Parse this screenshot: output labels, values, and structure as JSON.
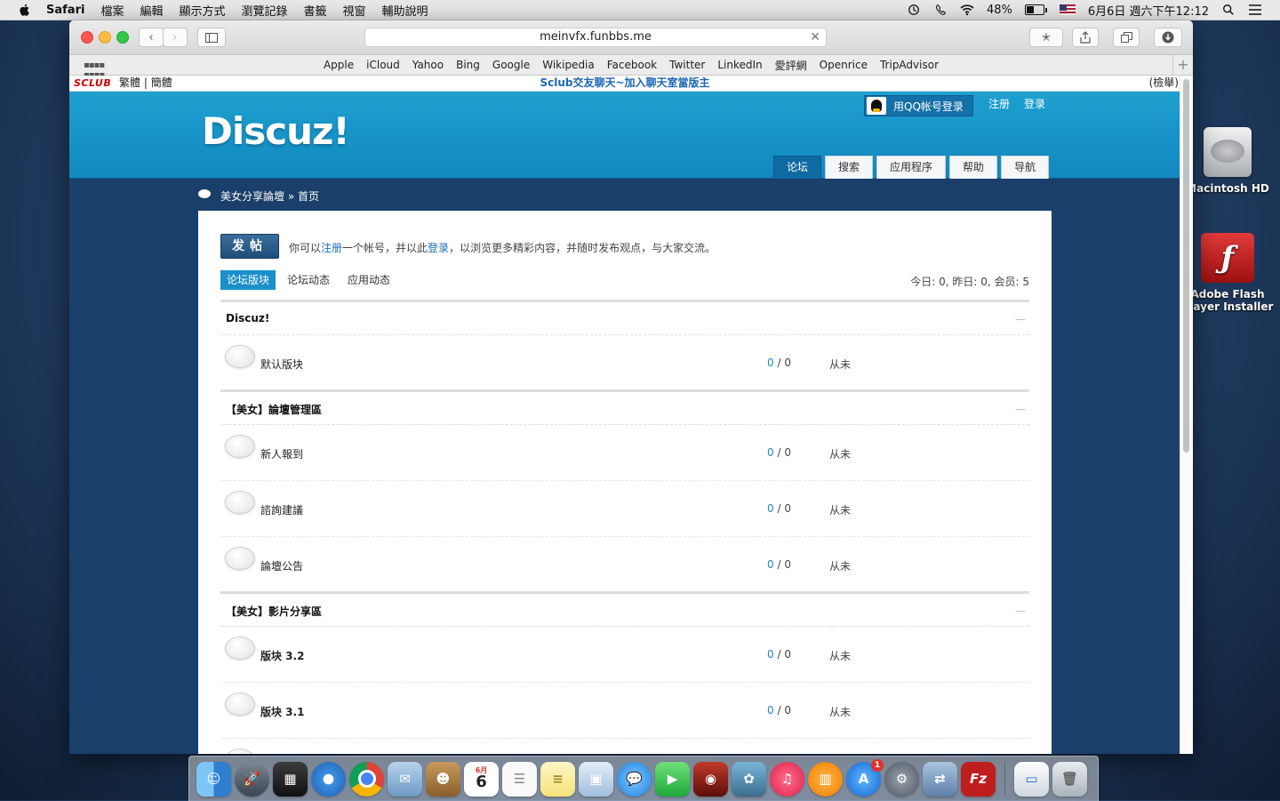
{
  "menubar": {
    "app_name": "Safari",
    "items": [
      "檔案",
      "編輯",
      "顯示方式",
      "瀏覽記錄",
      "書籤",
      "視窗",
      "輔助說明"
    ],
    "battery": "48%",
    "clock": "6月6日 週六下午12:12"
  },
  "desktop": {
    "icons": [
      {
        "label": "Macintosh HD"
      },
      {
        "label": "Adobe Flash Player Installer"
      }
    ]
  },
  "browser": {
    "url": "meinvfx.funbbs.me",
    "favorites": [
      "Apple",
      "iCloud",
      "Yahoo",
      "Bing",
      "Google",
      "Wikipedia",
      "Facebook",
      "Twitter",
      "LinkedIn",
      "愛評網",
      "Openrice",
      "TripAdvisor"
    ]
  },
  "sclub": {
    "logo": "SCLUB",
    "lang_trad": "繁體",
    "lang_sep": "|",
    "lang_simp": "簡體",
    "center": "Sclub交友聊天~加入聊天室當版主",
    "report": "(檢舉)"
  },
  "header": {
    "logo": "Discuz!",
    "qq_login": "用QQ帐号登录",
    "register": "注册",
    "login": "登录",
    "nav": [
      "论坛",
      "搜索",
      "应用程序",
      "帮助",
      "导航"
    ]
  },
  "breadcrumb": {
    "site": "美女分享論壇",
    "sep": "»",
    "page": "首页"
  },
  "main": {
    "post_button": "发帖",
    "welcome_prefix": "你可以",
    "welcome_register": "注册",
    "welcome_middle": "一个帐号，并以此",
    "welcome_login": "登录",
    "welcome_suffix": "，以浏览更多精彩内容，并随时发布观点，与大家交流。",
    "tabs": [
      "论坛版块",
      "论坛动态",
      "应用动态"
    ],
    "stats": "今日: 0, 昨日: 0, 会员: 5",
    "sections": [
      {
        "title": "Discuz!",
        "forums": [
          {
            "name": "默认版块",
            "threads": "0",
            "posts": "0",
            "last": "从未"
          }
        ]
      },
      {
        "title": "【美女】論壇管理區",
        "forums": [
          {
            "name": "新人報到",
            "threads": "0",
            "posts": "0",
            "last": "从未"
          },
          {
            "name": "諮詢建議",
            "threads": "0",
            "posts": "0",
            "last": "从未"
          },
          {
            "name": "論壇公告",
            "threads": "0",
            "posts": "0",
            "last": "从未"
          }
        ]
      },
      {
        "title": "【美女】影片分享區",
        "forums": [
          {
            "name": "版块 3.2",
            "threads": "0",
            "posts": "0",
            "last": "从未"
          },
          {
            "name": "版块 3.1",
            "threads": "0",
            "posts": "0",
            "last": "从未"
          }
        ]
      }
    ]
  },
  "dock": {
    "apps": [
      "finder-icon",
      "launchpad-icon",
      "mission-control-icon",
      "safari-icon",
      "chrome-icon",
      "mail-icon",
      "contacts-icon",
      "calendar-icon",
      "reminders-icon",
      "notes-icon",
      "preview-icon",
      "messages-icon",
      "facetime-icon",
      "photo-booth-icon",
      "iphoto-icon",
      "itunes-icon",
      "ibooks-icon",
      "app-store-icon",
      "system-preferences-icon",
      "migration-icon",
      "filezilla-icon",
      "chrome-window-icon",
      "trash-icon"
    ],
    "calendar_day": "6",
    "calendar_month": "6月",
    "app_store_badge": "1",
    "filezilla_label": "Fz"
  }
}
